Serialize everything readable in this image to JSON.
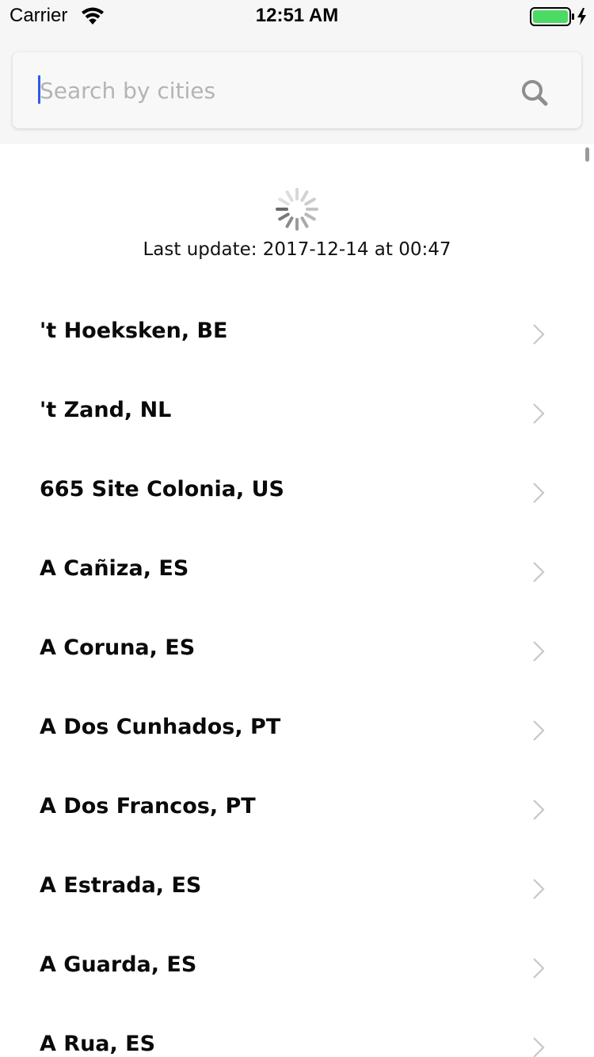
{
  "status_bar": {
    "carrier": "Carrier",
    "time": "12:51 AM",
    "battery_color": "#4cd964",
    "icons": [
      "wifi-icon",
      "battery-icon"
    ]
  },
  "search": {
    "placeholder": "Search by cities",
    "value": "",
    "caret_color": "#2d5be3",
    "icon": "search-icon"
  },
  "refresh": {
    "last_update": "Last update: 2017-12-14 at 00:47",
    "icon": "spinner-icon"
  },
  "cities": [
    {
      "label": "'t Hoeksken, BE"
    },
    {
      "label": "'t Zand, NL"
    },
    {
      "label": "665 Site Colonia, US"
    },
    {
      "label": "A Cañiza, ES"
    },
    {
      "label": "A Coruna, ES"
    },
    {
      "label": "A Dos Cunhados, PT"
    },
    {
      "label": "A Dos Francos, PT"
    },
    {
      "label": "A Estrada, ES"
    },
    {
      "label": "A Guarda, ES"
    },
    {
      "label": "A Rua, ES"
    }
  ],
  "colors": {
    "header_bg": "#f6f6f6",
    "chevron": "#c7c7cc",
    "text": "#0a0a0a"
  }
}
